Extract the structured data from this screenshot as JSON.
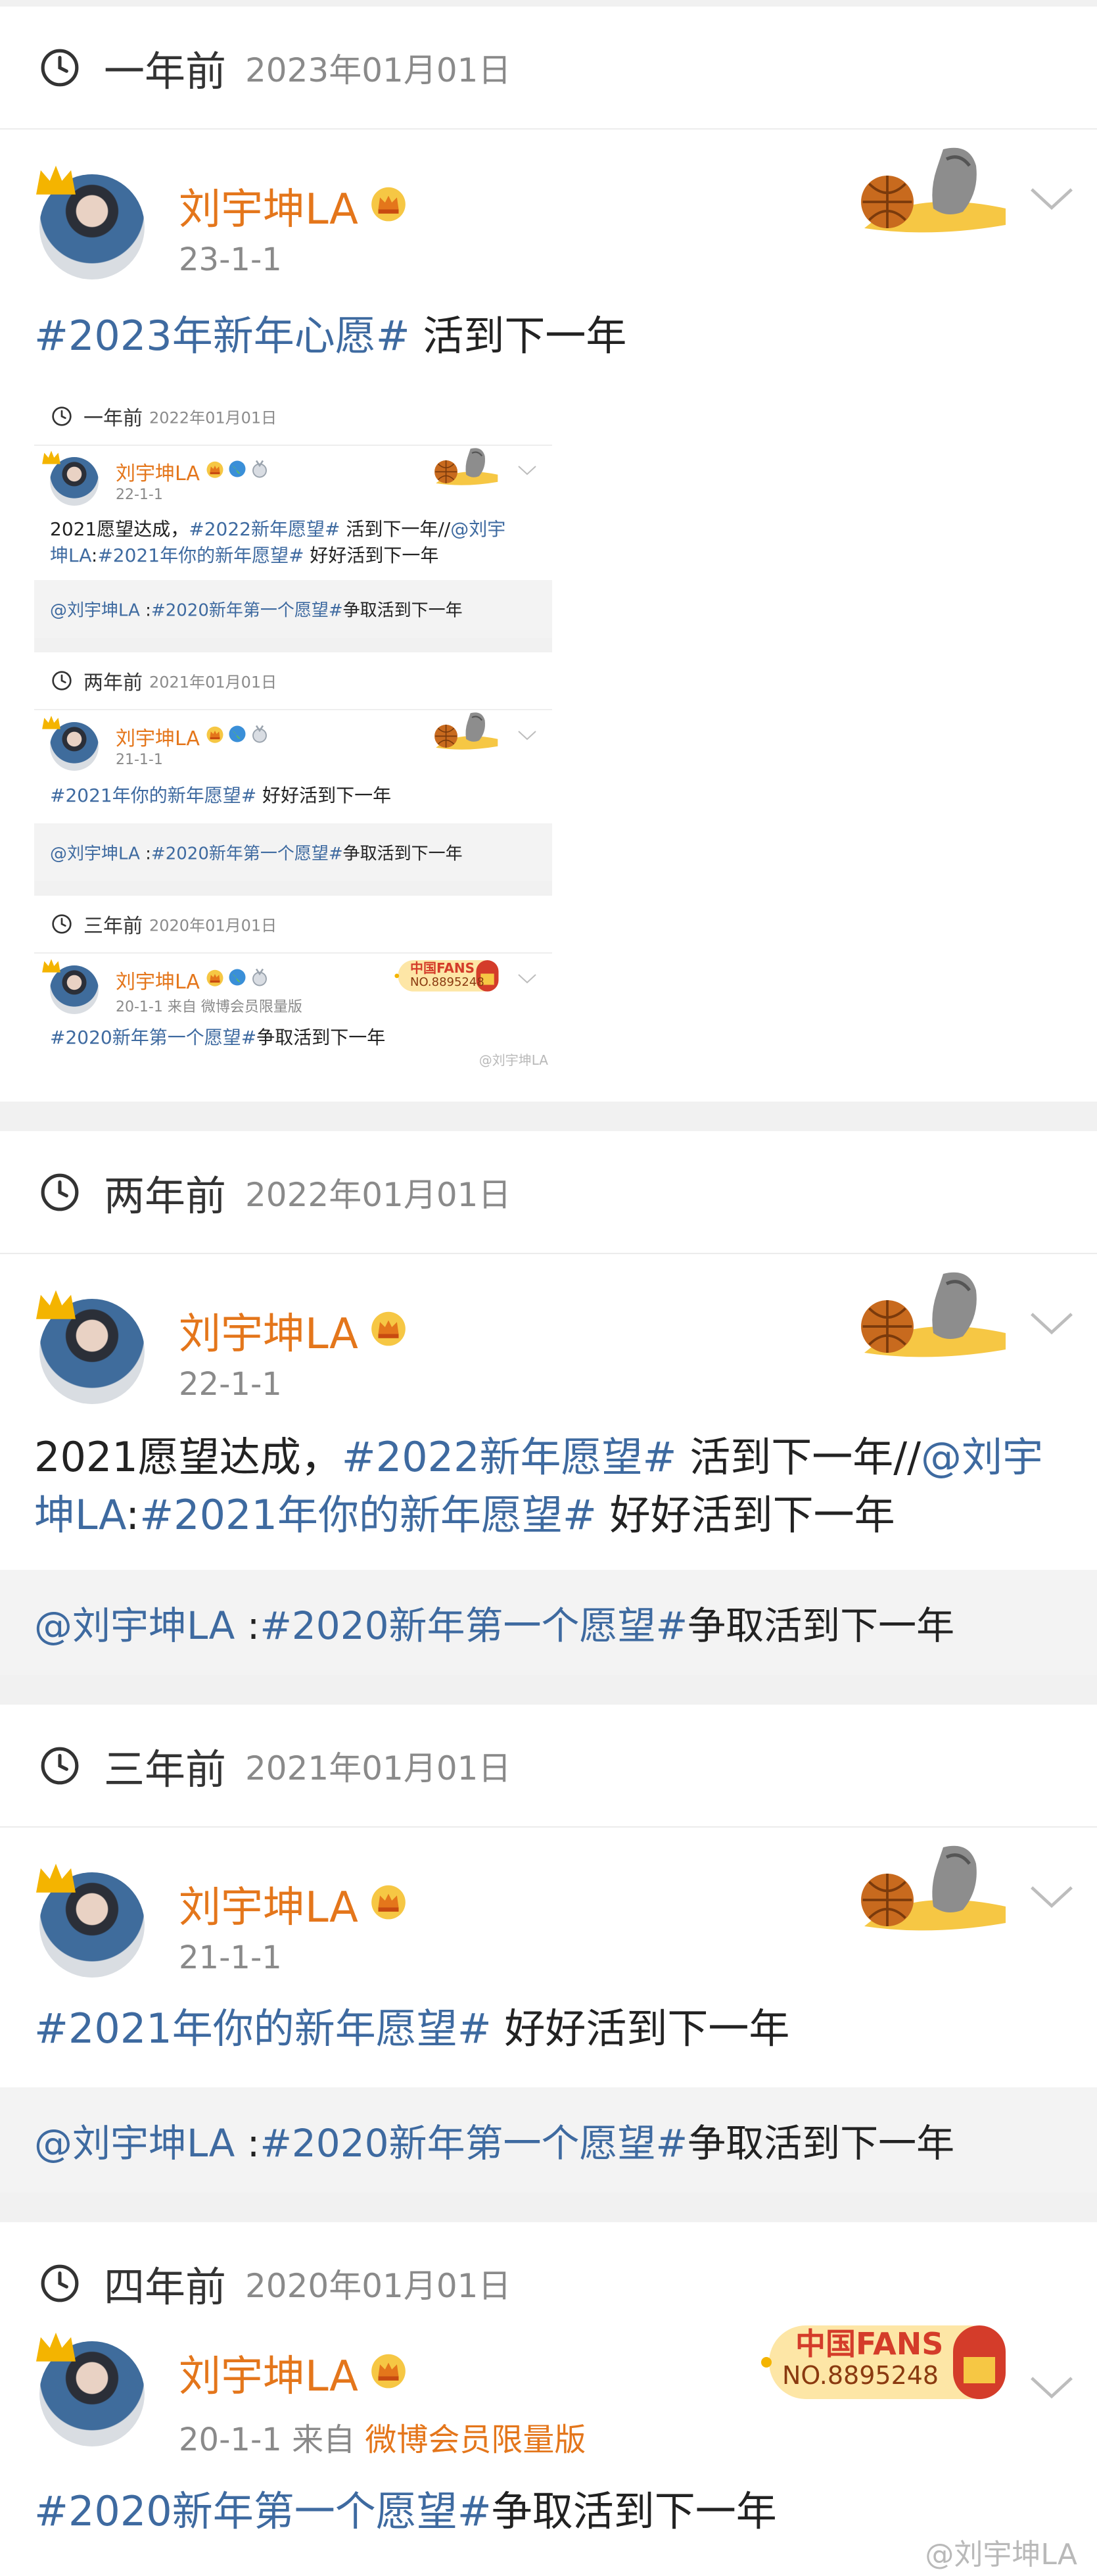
{
  "user": {
    "name": "刘宇坤LA"
  },
  "colors": {
    "accent_orange": "#e4761b",
    "link_blue": "#3e6aa0",
    "muted_gray": "#8a8a8a"
  },
  "icons": [
    "clock-icon",
    "crown-icon",
    "vip-crown-icon",
    "chevron-down-icon",
    "basketball-deco-icon",
    "china-fans-badge-icon",
    "globe-badge-icon",
    "medal-badge-icon"
  ],
  "sections": [
    {
      "title": "一年前",
      "date": "2023年01月01日",
      "post": {
        "time": "23-1-1",
        "text_parts": [
          "#2023年新年心愿#",
          " 活到下一年"
        ]
      },
      "embedded": {
        "sections": [
          {
            "title": "一年前",
            "date": "2022年01月01日",
            "time": "22-1-1",
            "line1": [
              "2021愿望达成，",
              "#2022新年愿望#",
              " 活到下一年//",
              "@刘宇"
            ],
            "line2": [
              "坤LA",
              ":",
              "#2021年你的新年愿望#",
              " 好好活到下一年"
            ],
            "repost": [
              "@刘宇坤LA",
              " :",
              "#2020新年第一个愿望#",
              "争取活到下一年"
            ]
          },
          {
            "title": "两年前",
            "date": "2021年01月01日",
            "time": "21-1-1",
            "line1": [
              "#2021年你的新年愿望#",
              " 好好活到下一年"
            ],
            "repost": [
              "@刘宇坤LA",
              " :",
              "#2020新年第一个愿望#",
              "争取活到下一年"
            ]
          },
          {
            "title": "三年前",
            "date": "2020年01月01日",
            "time_prefix": "20-1-1",
            "source_label": "来自",
            "source": "微博会员限量版",
            "line1": [
              "#2020新年第一个愿望#",
              "争取活到下一年"
            ],
            "fans_text": "中国FANS",
            "fans_no": "NO.8895248",
            "watermark": "@刘宇坤LA"
          }
        ]
      }
    },
    {
      "title": "两年前",
      "date": "2022年01月01日",
      "post": {
        "time": "22-1-1",
        "line1": [
          "2021愿望达成，",
          "#2022新年愿望#",
          " 活到下一年//",
          "@刘宇"
        ],
        "line2": [
          "坤LA",
          ":",
          "#2021年你的新年愿望#",
          " 好好活到下一年"
        ]
      },
      "repost": [
        "@刘宇坤LA",
        " :",
        "#2020新年第一个愿望#",
        "争取活到下一年"
      ]
    },
    {
      "title": "三年前",
      "date": "2021年01月01日",
      "post": {
        "time": "21-1-1",
        "text_parts": [
          "#2021年你的新年愿望#",
          " 好好活到下一年"
        ]
      },
      "repost": [
        "@刘宇坤LA",
        " :",
        "#2020新年第一个愿望#",
        "争取活到下一年"
      ]
    },
    {
      "title": "四年前",
      "date": "2020年01月01日",
      "post": {
        "time": "20-1-1",
        "source_label": "来自",
        "source": "微博会员限量版",
        "text_parts": [
          "#2020新年第一个愿望#",
          "争取活到下一年"
        ],
        "fans_text": "中国FANS",
        "fans_no": "NO.8895248"
      }
    }
  ],
  "watermark": "@刘宇坤LA"
}
